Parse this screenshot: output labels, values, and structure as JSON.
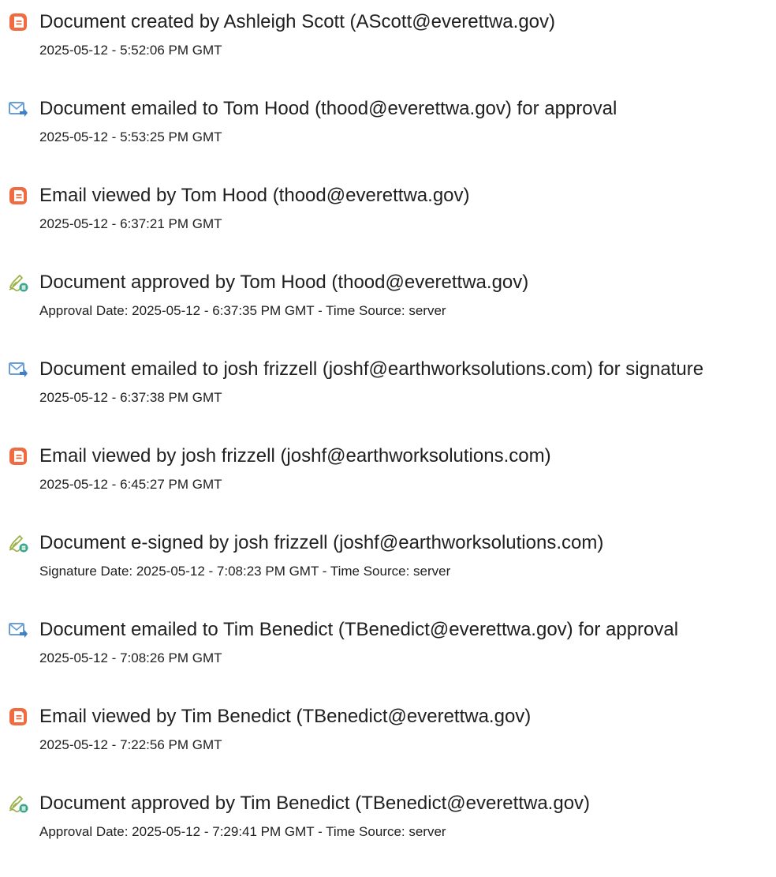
{
  "colors": {
    "document_icon": "#f06b3f",
    "email_icon": "#6a9fd6",
    "email_arrow": "#3f7fc7",
    "sign_icon": "#9bb24a",
    "sign_badge": "#3aa78d",
    "text": "#202020"
  },
  "events": [
    {
      "icon": "document-icon",
      "title": "Document created by Ashleigh Scott (AScott@everettwa.gov)",
      "detail": "2025-05-12 - 5:52:06 PM GMT"
    },
    {
      "icon": "email-sent-icon",
      "title": "Document emailed to Tom Hood (thood@everettwa.gov) for approval",
      "detail": "2025-05-12 - 5:53:25 PM GMT"
    },
    {
      "icon": "document-icon",
      "title": "Email viewed by Tom Hood (thood@everettwa.gov)",
      "detail": "2025-05-12 - 6:37:21 PM GMT"
    },
    {
      "icon": "pen-sign-icon",
      "title": "Document approved by Tom Hood (thood@everettwa.gov)",
      "detail": "Approval Date: 2025-05-12 - 6:37:35 PM GMT - Time Source: server"
    },
    {
      "icon": "email-sent-icon",
      "title": "Document emailed to josh frizzell (joshf@earthworksolutions.com) for signature",
      "detail": "2025-05-12 - 6:37:38 PM GMT"
    },
    {
      "icon": "document-icon",
      "title": "Email viewed by josh frizzell (joshf@earthworksolutions.com)",
      "detail": "2025-05-12 - 6:45:27 PM GMT"
    },
    {
      "icon": "pen-sign-icon",
      "title": "Document e-signed by josh frizzell (joshf@earthworksolutions.com)",
      "detail": "Signature Date: 2025-05-12 - 7:08:23 PM GMT - Time Source: server"
    },
    {
      "icon": "email-sent-icon",
      "title": "Document emailed to Tim Benedict (TBenedict@everettwa.gov) for approval",
      "detail": "2025-05-12 - 7:08:26 PM GMT"
    },
    {
      "icon": "document-icon",
      "title": "Email viewed by Tim Benedict (TBenedict@everettwa.gov)",
      "detail": "2025-05-12 - 7:22:56 PM GMT"
    },
    {
      "icon": "pen-sign-icon",
      "title": "Document approved by Tim Benedict (TBenedict@everettwa.gov)",
      "detail": "Approval Date: 2025-05-12 - 7:29:41 PM GMT - Time Source: server"
    }
  ]
}
